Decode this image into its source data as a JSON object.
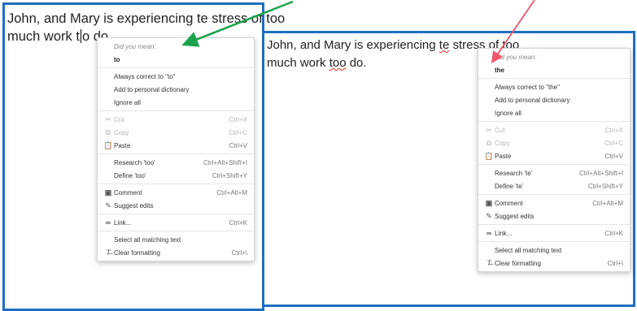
{
  "left": {
    "doc_line1": "John, and Mary is experiencing te stress of too",
    "doc_line2_before": "much work t",
    "doc_line2_after": "o do.",
    "menu": {
      "did_you_mean": "Did you mean:",
      "suggestion": "to",
      "always_correct": "Always correct to \"to\"",
      "add_dictionary": "Add to personal dictionary",
      "ignore_all": "Ignore all",
      "cut": "Cut",
      "cut_sc": "Ctrl+X",
      "copy": "Copy",
      "copy_sc": "Ctrl+C",
      "paste": "Paste",
      "paste_sc": "Ctrl+V",
      "research": "Research 'too'",
      "research_sc": "Ctrl+Alt+Shift+I",
      "define": "Define 'too'",
      "define_sc": "Ctrl+Shift+Y",
      "comment": "Comment",
      "comment_sc": "Ctrl+Alt+M",
      "suggest_edits": "Suggest edits",
      "link": "Link...",
      "link_sc": "Ctrl+K",
      "select_matching": "Select all matching text",
      "clear_formatting": "Clear formatting",
      "clear_sc": "Ctrl+\\"
    }
  },
  "right": {
    "doc_line1_a": "John, and Mary is experiencing ",
    "doc_line1_err": "te",
    "doc_line1_b": " stress of too",
    "doc_line2_a": "much work ",
    "doc_line2_err": "too",
    "doc_line2_b": " do.",
    "menu": {
      "did_you_mean": "Did you mean:",
      "suggestion": "the",
      "always_correct": "Always correct to \"the\"",
      "add_dictionary": "Add to personal dictionary",
      "ignore_all": "Ignore all",
      "cut": "Cut",
      "cut_sc": "Ctrl+X",
      "copy": "Copy",
      "copy_sc": "Ctrl+C",
      "paste": "Paste",
      "paste_sc": "Ctrl+V",
      "research": "Research 'te'",
      "research_sc": "Ctrl+Alt+Shift+I",
      "define": "Define 'te'",
      "define_sc": "Ctrl+Shift+Y",
      "comment": "Comment",
      "comment_sc": "Ctrl+Alt+M",
      "suggest_edits": "Suggest edits",
      "link": "Link...",
      "link_sc": "Ctrl+K",
      "select_matching": "Select all matching text",
      "clear_formatting": "Clear formatting",
      "clear_sc": "Ctrl+\\"
    }
  },
  "colors": {
    "panel_border": "#1f6fbf",
    "green_arrow": "#1aa34a",
    "red_arrow": "#f2556b",
    "misspell": "#d93025"
  },
  "icons": [
    "cut-icon",
    "copy-icon",
    "paste-icon",
    "comment-icon",
    "suggest-edits-icon",
    "link-icon",
    "clear-formatting-icon"
  ]
}
